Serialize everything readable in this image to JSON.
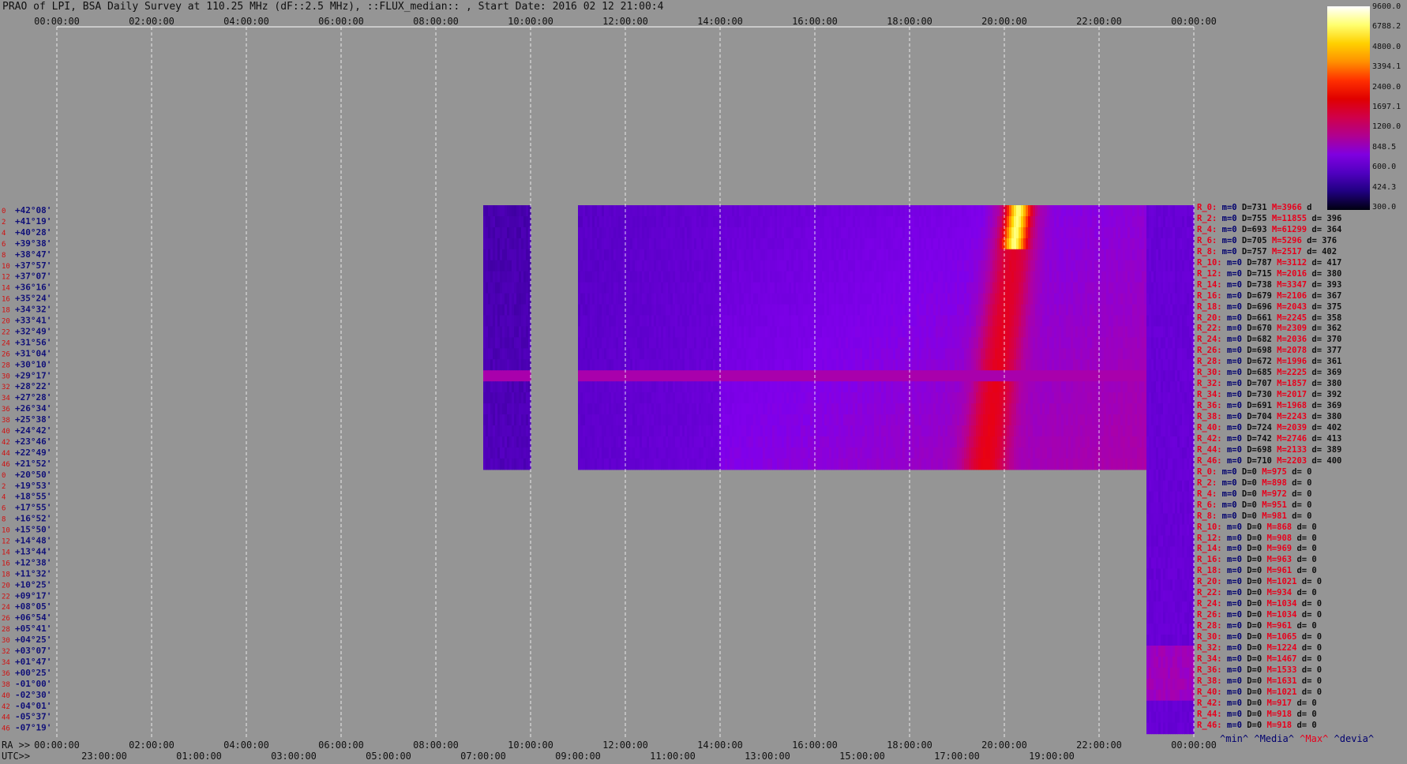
{
  "title": "PRAO of LPI, BSA Daily Survey at 110.25 MHz (dF::2.5 MHz), ::FLUX_median:: , Start Date: 2016 02 12 21:00:4",
  "top_axis_ticks": [
    "00:00:00",
    "02:00:00",
    "04:00:00",
    "06:00:00",
    "08:00:00",
    "10:00:00",
    "12:00:00",
    "14:00:00",
    "16:00:00",
    "18:00:00",
    "20:00:00",
    "22:00:00",
    "00:00:00"
  ],
  "bottom_axis_ra_prefix": "RA >>",
  "bottom_axis_ra_ticks": [
    "00:00:00",
    "02:00:00",
    "04:00:00",
    "06:00:00",
    "08:00:00",
    "10:00:00",
    "12:00:00",
    "14:00:00",
    "16:00:00",
    "18:00:00",
    "20:00:00",
    "22:00:00",
    "00:00:00"
  ],
  "bottom_axis_utc_prefix": "UTC>>",
  "bottom_axis_utc_ticks": [
    "23:00:00",
    "01:00:00",
    "03:00:00",
    "05:00:00",
    "07:00:00",
    "09:00:00",
    "11:00:00",
    "13:00:00",
    "15:00:00",
    "17:00:00",
    "19:00:00"
  ],
  "colorbar": {
    "labels": [
      "9600.0",
      "6788.2",
      "4800.0",
      "3394.1",
      "2400.0",
      "1697.1",
      "1200.0",
      "848.5",
      "600.0",
      "424.3",
      "300.0"
    ],
    "colors": [
      "#ffffff",
      "#ffff70",
      "#ffd000",
      "#ff9000",
      "#ff3000",
      "#e00000",
      "#d0004a",
      "#b00090",
      "#8000e0",
      "#5000c0",
      "#200080",
      "#000010"
    ]
  },
  "chart_data": {
    "type": "heatmap",
    "title": "PRAO of LPI, BSA Daily Survey at 110.25 MHz (dF::2.5 MHz), ::FLUX_median:: , Start Date: 2016 02 12 21:00:4",
    "x_axis": "RA (hours), 0 to 24",
    "y_axis": "Declination",
    "value_unit": "flux median",
    "color_scale": "log",
    "vmin": 300.0,
    "vmax": 9600.0,
    "dec_labels": [
      "+42°08'",
      "+41°19'",
      "+40°28'",
      "+39°38'",
      "+38°47'",
      "+37°57'",
      "+37°07'",
      "+36°16'",
      "+35°24'",
      "+34°32'",
      "+33°41'",
      "+32°49'",
      "+31°56'",
      "+31°04'",
      "+30°10'",
      "+29°17'",
      "+28°22'",
      "+27°28'",
      "+26°34'",
      "+25°38'",
      "+24°42'",
      "+23°46'",
      "+22°49'",
      "+21°52'",
      "+20°50'",
      "+19°53'",
      "+18°55'",
      "+17°55'",
      "+16°52'",
      "+15°50'",
      "+14°48'",
      "+13°44'",
      "+12°38'",
      "+11°32'",
      "+10°25'",
      "+09°17'",
      "+08°05'",
      "+06°54'",
      "+05°41'",
      "+04°25'",
      "+03°07'",
      "+01°47'",
      "+00°25'",
      "-01°00'",
      "-02°30'",
      "-04°01'",
      "-05°37'",
      "-07°19'"
    ],
    "row_index_labels": [
      "0",
      "2",
      "4",
      "6",
      "8",
      "10",
      "12",
      "14",
      "16",
      "18",
      "20",
      "22",
      "24",
      "26",
      "28",
      "30",
      "32",
      "34",
      "36",
      "38",
      "40",
      "42",
      "44",
      "46",
      "0",
      "2",
      "4",
      "6",
      "8",
      "10",
      "12",
      "14",
      "16",
      "18",
      "20",
      "22",
      "24",
      "26",
      "28",
      "30",
      "32",
      "34",
      "36",
      "38",
      "40",
      "42",
      "44",
      "46"
    ],
    "coverage": [
      {
        "dec_rows": [
          0,
          23
        ],
        "ra_ranges": [
          [
            9.0,
            10.0
          ],
          [
            11.0,
            23.0
          ]
        ]
      },
      {
        "dec_rows": [
          0,
          47
        ],
        "ra_ranges": [
          [
            23.0,
            24.0
          ]
        ]
      }
    ],
    "features": [
      {
        "name": "bright source track",
        "ra_top": 20.3,
        "ra_bottom": 19.6,
        "dec_rows": [
          0,
          23
        ],
        "peak_value": 9600
      },
      {
        "name": "horizontal band",
        "dec_row": 15,
        "value": 1500
      }
    ]
  },
  "stats_rows": [
    {
      "r": "R_0:",
      "m": "m=0",
      "d": "D=731",
      "M": "M=3966",
      "dv": "d"
    },
    {
      "r": "R_2:",
      "m": "m=0",
      "d": "D=755",
      "M": "M=11855",
      "dv": "d= 396"
    },
    {
      "r": "R_4:",
      "m": "m=0",
      "d": "D=693",
      "M": "M=61299",
      "dv": "d= 364"
    },
    {
      "r": "R_6:",
      "m": "m=0",
      "d": "D=705",
      "M": "M=5296",
      "dv": "d= 376"
    },
    {
      "r": "R_8:",
      "m": "m=0",
      "d": "D=757",
      "M": "M=2517",
      "dv": "d= 402"
    },
    {
      "r": "R_10:",
      "m": "m=0",
      "d": "D=787",
      "M": "M=3112",
      "dv": "d= 417"
    },
    {
      "r": "R_12:",
      "m": "m=0",
      "d": "D=715",
      "M": "M=2016",
      "dv": "d= 380"
    },
    {
      "r": "R_14:",
      "m": "m=0",
      "d": "D=738",
      "M": "M=3347",
      "dv": "d= 393"
    },
    {
      "r": "R_16:",
      "m": "m=0",
      "d": "D=679",
      "M": "M=2106",
      "dv": "d= 367"
    },
    {
      "r": "R_18:",
      "m": "m=0",
      "d": "D=696",
      "M": "M=2043",
      "dv": "d= 375"
    },
    {
      "r": "R_20:",
      "m": "m=0",
      "d": "D=661",
      "M": "M=2245",
      "dv": "d= 358"
    },
    {
      "r": "R_22:",
      "m": "m=0",
      "d": "D=670",
      "M": "M=2309",
      "dv": "d= 362"
    },
    {
      "r": "R_24:",
      "m": "m=0",
      "d": "D=682",
      "M": "M=2036",
      "dv": "d= 370"
    },
    {
      "r": "R_26:",
      "m": "m=0",
      "d": "D=698",
      "M": "M=2078",
      "dv": "d= 377"
    },
    {
      "r": "R_28:",
      "m": "m=0",
      "d": "D=672",
      "M": "M=1996",
      "dv": "d= 361"
    },
    {
      "r": "R_30:",
      "m": "m=0",
      "d": "D=685",
      "M": "M=2225",
      "dv": "d= 369"
    },
    {
      "r": "R_32:",
      "m": "m=0",
      "d": "D=707",
      "M": "M=1857",
      "dv": "d= 380"
    },
    {
      "r": "R_34:",
      "m": "m=0",
      "d": "D=730",
      "M": "M=2017",
      "dv": "d= 392"
    },
    {
      "r": "R_36:",
      "m": "m=0",
      "d": "D=691",
      "M": "M=1968",
      "dv": "d= 369"
    },
    {
      "r": "R_38:",
      "m": "m=0",
      "d": "D=704",
      "M": "M=2243",
      "dv": "d= 380"
    },
    {
      "r": "R_40:",
      "m": "m=0",
      "d": "D=724",
      "M": "M=2039",
      "dv": "d= 402"
    },
    {
      "r": "R_42:",
      "m": "m=0",
      "d": "D=742",
      "M": "M=2746",
      "dv": "d= 413"
    },
    {
      "r": "R_44:",
      "m": "m=0",
      "d": "D=698",
      "M": "M=2133",
      "dv": "d= 389"
    },
    {
      "r": "R_46:",
      "m": "m=0",
      "d": "D=710",
      "M": "M=2203",
      "dv": "d= 400"
    },
    {
      "r": "R_0:",
      "m": "m=0",
      "d": "D=0",
      "M": "M=975",
      "dv": "d= 0"
    },
    {
      "r": "R_2:",
      "m": "m=0",
      "d": "D=0",
      "M": "M=898",
      "dv": "d= 0"
    },
    {
      "r": "R_4:",
      "m": "m=0",
      "d": "D=0",
      "M": "M=972",
      "dv": "d= 0"
    },
    {
      "r": "R_6:",
      "m": "m=0",
      "d": "D=0",
      "M": "M=951",
      "dv": "d= 0"
    },
    {
      "r": "R_8:",
      "m": "m=0",
      "d": "D=0",
      "M": "M=981",
      "dv": "d= 0"
    },
    {
      "r": "R_10:",
      "m": "m=0",
      "d": "D=0",
      "M": "M=868",
      "dv": "d= 0"
    },
    {
      "r": "R_12:",
      "m": "m=0",
      "d": "D=0",
      "M": "M=908",
      "dv": "d= 0"
    },
    {
      "r": "R_14:",
      "m": "m=0",
      "d": "D=0",
      "M": "M=969",
      "dv": "d= 0"
    },
    {
      "r": "R_16:",
      "m": "m=0",
      "d": "D=0",
      "M": "M=963",
      "dv": "d= 0"
    },
    {
      "r": "R_18:",
      "m": "m=0",
      "d": "D=0",
      "M": "M=961",
      "dv": "d= 0"
    },
    {
      "r": "R_20:",
      "m": "m=0",
      "d": "D=0",
      "M": "M=1021",
      "dv": "d= 0"
    },
    {
      "r": "R_22:",
      "m": "m=0",
      "d": "D=0",
      "M": "M=934",
      "dv": "d= 0"
    },
    {
      "r": "R_24:",
      "m": "m=0",
      "d": "D=0",
      "M": "M=1034",
      "dv": "d= 0"
    },
    {
      "r": "R_26:",
      "m": "m=0",
      "d": "D=0",
      "M": "M=1034",
      "dv": "d= 0"
    },
    {
      "r": "R_28:",
      "m": "m=0",
      "d": "D=0",
      "M": "M=961",
      "dv": "d= 0"
    },
    {
      "r": "R_30:",
      "m": "m=0",
      "d": "D=0",
      "M": "M=1065",
      "dv": "d= 0"
    },
    {
      "r": "R_32:",
      "m": "m=0",
      "d": "D=0",
      "M": "M=1224",
      "dv": "d= 0"
    },
    {
      "r": "R_34:",
      "m": "m=0",
      "d": "D=0",
      "M": "M=1467",
      "dv": "d= 0"
    },
    {
      "r": "R_36:",
      "m": "m=0",
      "d": "D=0",
      "M": "M=1533",
      "dv": "d= 0"
    },
    {
      "r": "R_38:",
      "m": "m=0",
      "d": "D=0",
      "M": "M=1631",
      "dv": "d= 0"
    },
    {
      "r": "R_40:",
      "m": "m=0",
      "d": "D=0",
      "M": "M=1021",
      "dv": "d= 0"
    },
    {
      "r": "R_42:",
      "m": "m=0",
      "d": "D=0",
      "M": "M=917",
      "dv": "d= 0"
    },
    {
      "r": "R_44:",
      "m": "m=0",
      "d": "D=0",
      "M": "M=918",
      "dv": "d= 0"
    },
    {
      "r": "R_46:",
      "m": "m=0",
      "d": "D=0",
      "M": "M=918",
      "dv": "d= 0"
    }
  ],
  "legend": {
    "min": "^min^",
    "media": "^Media^",
    "max": "^Max^",
    "devia": "^devia^",
    "min_color": "#00006e",
    "max_color": "#e8001c"
  }
}
